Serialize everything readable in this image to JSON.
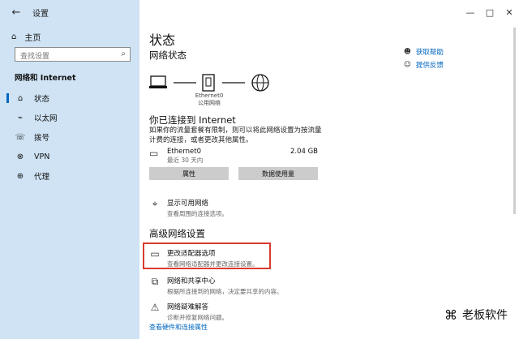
{
  "window": {
    "title": "设置",
    "controls": {
      "minimize": "—",
      "maximize": "□",
      "close": "✕"
    }
  },
  "sidebar": {
    "home_label": "主页",
    "search_placeholder": "查找设置",
    "section_title": "网络和 Internet",
    "items": [
      {
        "label": "状态",
        "icon": "home-icon",
        "active": true
      },
      {
        "label": "以太网",
        "icon": "ethernet-icon",
        "active": false
      },
      {
        "label": "拨号",
        "icon": "dialup-icon",
        "active": false
      },
      {
        "label": "VPN",
        "icon": "vpn-icon",
        "active": false
      },
      {
        "label": "代理",
        "icon": "globe-icon",
        "active": false
      }
    ]
  },
  "main": {
    "title": "状态",
    "network_status_title": "网络状态",
    "help_links": {
      "get_help": "获取帮助",
      "feedback": "提供反馈"
    },
    "diagram": {
      "adapter_name": "Ethernet0",
      "adapter_subtitle": "公用网络"
    },
    "connected_title": "你已连接到 Internet",
    "connected_desc": "如果你的流量套餐有限制，则可以将此网络设置为按流量计费的连接，或者更改其他属性。",
    "ethernet": {
      "name": "Ethernet0",
      "last": "最近 30 天内",
      "data_amount": "2.04 GB"
    },
    "buttons": {
      "properties": "属性",
      "data_usage": "数据使用量"
    },
    "show_networks": {
      "title": "显示可用网络",
      "desc": "查看周围的连接选项。"
    },
    "advanced_title": "高级网络设置",
    "change_adapter": {
      "title": "更改适配器选项",
      "desc": "查看网络适配器并更改连接设置。"
    },
    "sharing_center": {
      "title": "网络和共享中心",
      "desc": "根据所连接到的网络，决定要共享的内容。"
    },
    "troubleshooter": {
      "title": "网络疑难解答",
      "desc": "诊断并修复网络问题。"
    },
    "hardware_link": "查看硬件和连接属性"
  },
  "watermark": {
    "text": "老板软件"
  },
  "colors": {
    "accent": "#0067c0",
    "sidebar": "#cfe3f4",
    "highlight": "#d93b30"
  }
}
